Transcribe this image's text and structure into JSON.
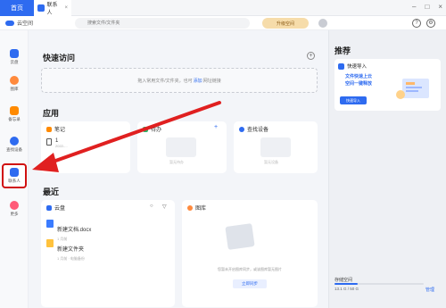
{
  "titlebar": {
    "home_tab": "首页",
    "contacts_tab": "联系人",
    "close_tab": "×"
  },
  "header": {
    "app_name": "云空间",
    "search_placeholder": "搜索文件/文件夹",
    "upgrade_label": "升级空间"
  },
  "sidebar": {
    "items": [
      {
        "label": "云盘",
        "icon": "cloud-drive-icon",
        "color": "#2e6bf0"
      },
      {
        "label": "图库",
        "icon": "gallery-icon",
        "color": "#ff8a3d"
      },
      {
        "label": "备忘录",
        "icon": "memo-icon",
        "color": "#ff8a00"
      },
      {
        "label": "查找设备",
        "icon": "find-device-icon",
        "color": "#2e6bf0"
      },
      {
        "label": "联系人",
        "icon": "contacts-icon",
        "color": "#2e6bf0"
      },
      {
        "label": "更多",
        "icon": "more-icon",
        "color": "#ff5a78"
      }
    ]
  },
  "quick_access": {
    "title": "快速访问",
    "hint_prefix": "拖入常用文件/文件夹，也可",
    "hint_link": "添加",
    "hint_suffix": "网址链接"
  },
  "apps": {
    "title": "应用",
    "notes": {
      "title": "笔记",
      "item_title": "1",
      "item_sub": "2022-..."
    },
    "todo": {
      "title": "待办",
      "empty": "暂无待办"
    },
    "find_device": {
      "title": "查找设备",
      "empty": "暂无设备"
    }
  },
  "recent": {
    "title": "最近",
    "drive": {
      "title": "云盘",
      "files": [
        {
          "name": "新建文档.docx",
          "meta": "1 月前"
        },
        {
          "name": "新建文件夹",
          "meta": "1 月前 · 电脑备份"
        }
      ]
    },
    "gallery": {
      "title": "图库",
      "hint": "您暂未开启图库同步，或该图库暂无图片",
      "button": "立即同步"
    }
  },
  "recommend": {
    "title": "推荐",
    "promo": {
      "header": "快速导入",
      "line1": "文件快速上云",
      "line2": "空间一键释放",
      "button": "快速导入"
    }
  },
  "storage": {
    "label": "存储空间",
    "text": "13.1 G / 50 G",
    "manage": "管理",
    "used_fraction": 0.26
  },
  "colors": {
    "accent": "#2e6bf0",
    "annotation": "#e02020"
  }
}
